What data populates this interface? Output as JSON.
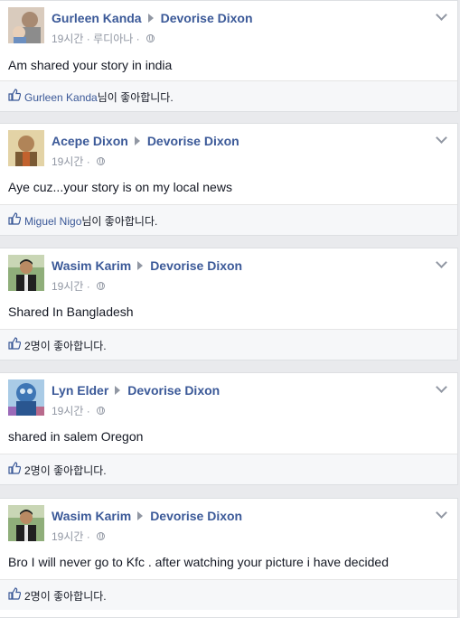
{
  "posts": [
    {
      "author": "Gurleen Kanda",
      "target": "Devorise Dixon",
      "time": "19시간",
      "location": "루디아나",
      "text": "Am shared your story in india",
      "like_name": "Gurleen Kanda",
      "like_suffix": "님이 좋아합니다.",
      "avatar_colors": [
        "#c8b7a6",
        "#e8d4c2",
        "#6a4d3a"
      ]
    },
    {
      "author": "Acepe Dixon",
      "target": "Devorise Dixon",
      "time": "19시간",
      "location": "",
      "text": "Aye cuz...your story is on my local news",
      "like_name": "Miguel Nigo",
      "like_suffix": "님이 좋아합니다.",
      "avatar_colors": [
        "#8a6a3a",
        "#c9a775",
        "#e6d6a8"
      ]
    },
    {
      "author": "Wasim Karim",
      "target": "Devorise Dixon",
      "time": "19시간",
      "location": "",
      "text": "Shared In Bangladesh",
      "like_name": "",
      "like_suffix": "2명이 좋아합니다.",
      "avatar_colors": [
        "#6d8f5a",
        "#2c2c2c",
        "#d7b08a"
      ]
    },
    {
      "author": "Lyn Elder",
      "target": "Devorise Dixon",
      "time": "19시간",
      "location": "",
      "text": "shared in salem Oregon",
      "like_name": "",
      "like_suffix": "2명이 좋아합니다.",
      "avatar_colors": [
        "#4a7fb8",
        "#b8d3ea",
        "#2b4d7a"
      ]
    },
    {
      "author": "Wasim Karim",
      "target": "Devorise Dixon",
      "time": "19시간",
      "location": "",
      "text": "Bro I will never go to Kfc . after watching your picture i have decided",
      "like_name": "",
      "like_suffix": "2명이 좋아합니다.",
      "avatar_colors": [
        "#6d8f5a",
        "#2c2c2c",
        "#d7b08a"
      ]
    }
  ],
  "meta_separator": " · ",
  "colors": {
    "link": "#3b5998",
    "muted": "#9197a3",
    "background": "#e9eaed"
  }
}
